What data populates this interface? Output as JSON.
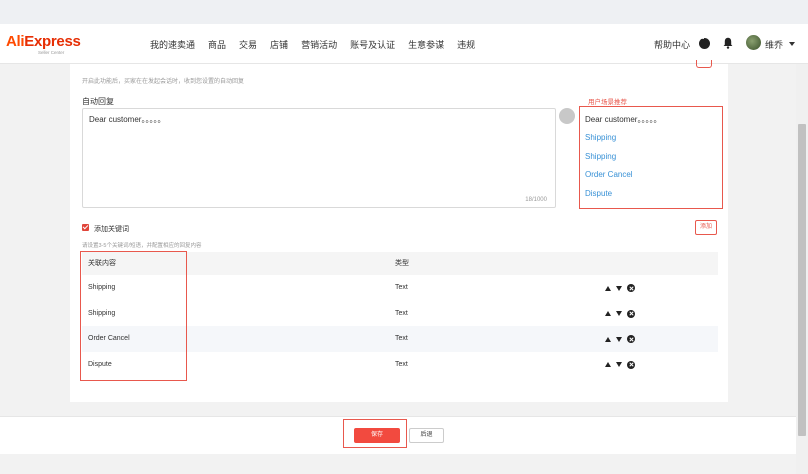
{
  "header": {
    "logo_main_a": "Ali",
    "logo_main_b": "Express",
    "logo_sub": "Seller Center",
    "nav": [
      "我的速卖通",
      "商品",
      "交易",
      "店铺",
      "营销活动",
      "账号及认证",
      "生意参谋",
      "违规"
    ],
    "help": "帮助中心",
    "username": "维乔"
  },
  "form": {
    "top_hint": "开启此功能后，买家在在发起会话时，收到您设置的自动回复",
    "auto_reply_label": "自动回复",
    "textarea_value": "Dear customer。。。。。",
    "char_count": "18/1000"
  },
  "recommend": {
    "title": "用户场景推荐",
    "items": [
      "Dear customer。。。。。",
      "Shipping",
      "Shipping",
      "Order Cancel",
      "Dispute"
    ]
  },
  "keywords": {
    "checkbox_label": "添加关键词",
    "hint": "请设置3-5个关键词/短语，并配置相应的回复内容",
    "add_button": "添加",
    "columns": [
      "关联内容",
      "类型"
    ],
    "rows": [
      {
        "content": "Shipping",
        "type": "Text"
      },
      {
        "content": "Shipping",
        "type": "Text"
      },
      {
        "content": "Order Cancel",
        "type": "Text"
      },
      {
        "content": "Dispute",
        "type": "Text"
      }
    ]
  },
  "footer": {
    "save": "保存",
    "back": "后退"
  },
  "colors": {
    "accent": "#f24a3f",
    "link": "#3891d6",
    "highlight": "#e8584d"
  }
}
